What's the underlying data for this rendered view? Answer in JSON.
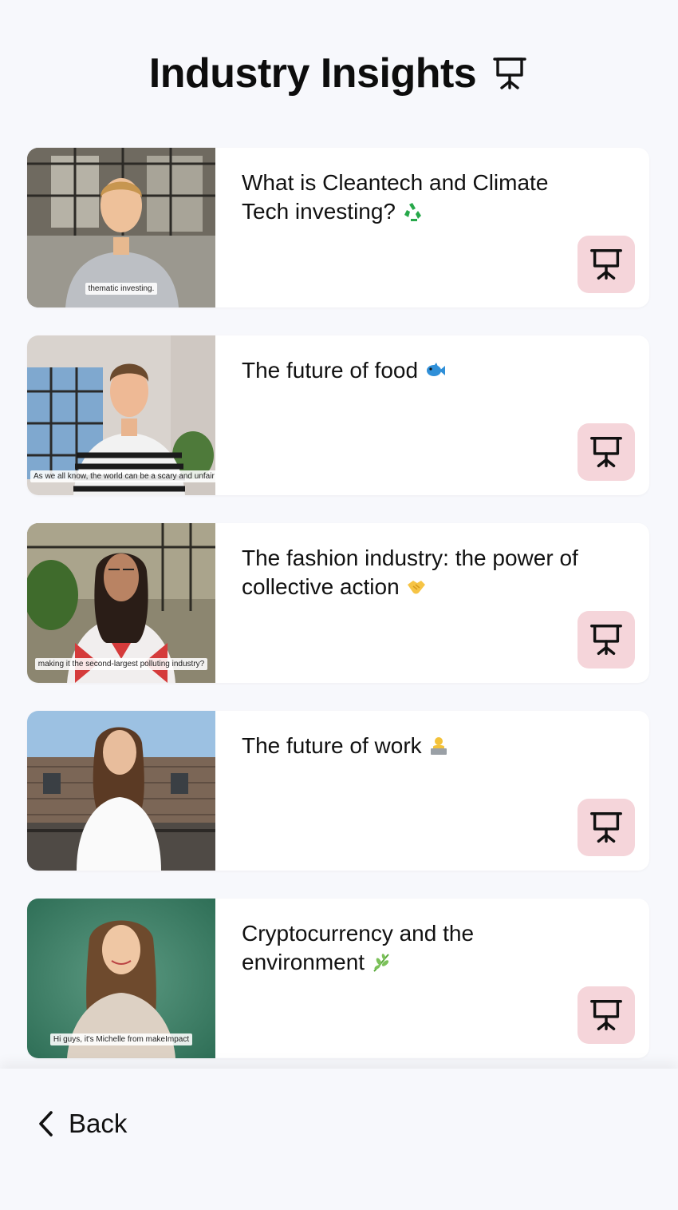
{
  "header": {
    "title": "Industry Insights",
    "icon": "presentation-icon"
  },
  "cards": [
    {
      "title": "What is Cleantech and Climate Tech investing?",
      "emoji": "recycle-icon",
      "caption": "thematic investing.",
      "button_icon": "presentation-icon"
    },
    {
      "title": "The future of food",
      "emoji": "fish-icon",
      "caption": "As we all know, the world can be a scary and unfair place.",
      "button_icon": "presentation-icon"
    },
    {
      "title": "The fashion industry: the power of collective action",
      "emoji": "handshake-icon",
      "caption": "making it the second-largest polluting industry?",
      "button_icon": "presentation-icon"
    },
    {
      "title": "The future of work",
      "emoji": "person-laptop-icon",
      "caption": "",
      "button_icon": "presentation-icon"
    },
    {
      "title": "Cryptocurrency and the environment",
      "emoji": "herb-icon",
      "caption": "Hi guys, it's Michelle from makeImpact",
      "button_icon": "presentation-icon"
    }
  ],
  "footer": {
    "back_label": "Back",
    "back_icon": "chevron-left-icon"
  },
  "colors": {
    "background": "#f7f8fc",
    "card": "#ffffff",
    "button_bg": "#f5d5da"
  }
}
